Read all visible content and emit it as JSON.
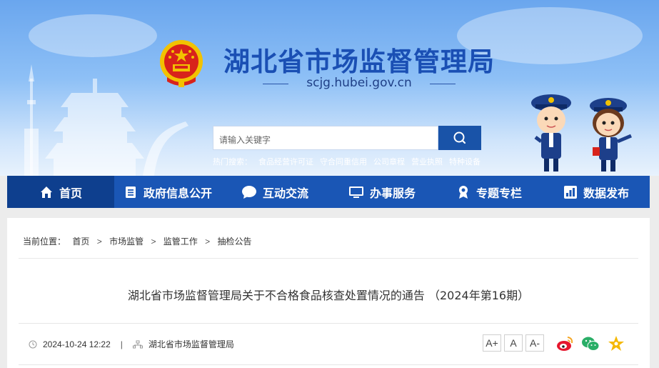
{
  "header": {
    "site_title": "湖北省市场监督管理局",
    "domain": "scjg.hubei.gov.cn",
    "search_placeholder": "请输入关键字",
    "hot_label": "热门搜索：",
    "hot_searches": [
      "食品经营许可证",
      "守合同重信用",
      "公司章程",
      "营业执照",
      "特种设备"
    ]
  },
  "nav": {
    "items": [
      {
        "label": "首页",
        "icon": "home-icon",
        "active": true
      },
      {
        "label": "政府信息公开",
        "icon": "document-list-icon",
        "active": false
      },
      {
        "label": "互动交流",
        "icon": "chat-bubble-icon",
        "active": false
      },
      {
        "label": "办事服务",
        "icon": "monitor-icon",
        "active": false
      },
      {
        "label": "专题专栏",
        "icon": "medal-icon",
        "active": false
      },
      {
        "label": "数据发布",
        "icon": "bar-chart-icon",
        "active": false
      }
    ]
  },
  "breadcrumb": {
    "label": "当前位置：",
    "items": [
      "首页",
      "市场监管",
      "监管工作",
      "抽检公告"
    ],
    "separator": ">"
  },
  "article": {
    "title": "湖北省市场监督管理局关于不合格食品核查处置情况的通告 （2024年第16期）",
    "date": "2024-10-24 12:22",
    "source": "湖北省市场监督管理局",
    "meta_separator": "|",
    "font_buttons": [
      "A+",
      "A",
      "A-"
    ]
  },
  "share": {
    "icons": [
      "weibo-icon",
      "wechat-icon",
      "favorite-star-icon"
    ]
  },
  "colors": {
    "nav_bg": "#1a56b5",
    "nav_active": "#0e3f8e",
    "title_blue": "#1a4fb4",
    "search_btn": "#1953a8"
  }
}
